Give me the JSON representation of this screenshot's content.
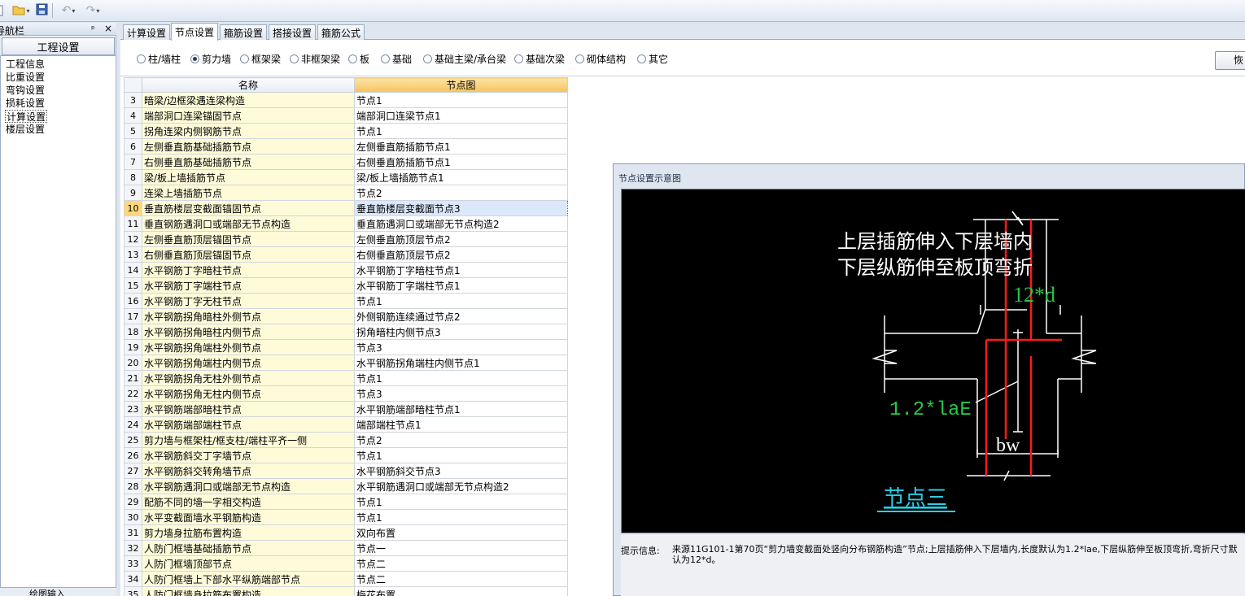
{
  "toolbar": {
    "buttons": [
      {
        "name": "open-icon"
      },
      {
        "name": "save-icon"
      },
      {
        "name": "undo-icon"
      },
      {
        "name": "redo-icon"
      }
    ]
  },
  "nav": {
    "title": "导航栏",
    "pin": "ᵖ",
    "close": "×",
    "header": "工程设置",
    "items": [
      {
        "label": "工程信息"
      },
      {
        "label": "比重设置"
      },
      {
        "label": "弯钩设置"
      },
      {
        "label": "损耗设置"
      },
      {
        "label": "计算设置",
        "selected": true
      },
      {
        "label": "楼层设置"
      }
    ],
    "bottom": "绘图输入"
  },
  "tabs": [
    {
      "label": "计算设置"
    },
    {
      "label": "节点设置",
      "active": true
    },
    {
      "label": "箍筋设置"
    },
    {
      "label": "搭接设置"
    },
    {
      "label": "箍筋公式"
    }
  ],
  "radios": [
    {
      "label": "柱/墙柱",
      "checked": false
    },
    {
      "label": "剪力墙",
      "checked": true
    },
    {
      "label": "框架梁",
      "checked": false
    },
    {
      "label": "非框架梁",
      "checked": false
    },
    {
      "label": "板",
      "checked": false
    },
    {
      "label": "基础",
      "checked": false
    },
    {
      "label": "基础主梁/承台梁",
      "checked": false
    },
    {
      "label": "基础次梁",
      "checked": false
    },
    {
      "label": "砌体结构",
      "checked": false
    },
    {
      "label": "其它",
      "checked": false
    }
  ],
  "restore_button": "恢",
  "grid": {
    "headers": {
      "name": "名称",
      "diagram": "节点图"
    },
    "rows": [
      {
        "no": "3",
        "name": "暗梁/边框梁遇连梁构造",
        "value": "节点1"
      },
      {
        "no": "4",
        "name": "端部洞口连梁锚固节点",
        "value": "端部洞口连梁节点1"
      },
      {
        "no": "5",
        "name": "拐角连梁内侧钢筋节点",
        "value": "节点1"
      },
      {
        "no": "6",
        "name": "左侧垂直筋基础插筋节点",
        "value": "左侧垂直筋插筋节点1"
      },
      {
        "no": "7",
        "name": "右侧垂直筋基础插筋节点",
        "value": "右侧垂直筋插筋节点1"
      },
      {
        "no": "8",
        "name": "梁/板上墙插筋节点",
        "value": "梁/板上墙插筋节点1"
      },
      {
        "no": "9",
        "name": "连梁上墙插筋节点",
        "value": "节点2"
      },
      {
        "no": "10",
        "name": "垂直筋楼层变截面锚固节点",
        "value": "垂直筋楼层变截面节点3",
        "selected": true
      },
      {
        "no": "11",
        "name": "垂直钢筋遇洞口或端部无节点构造",
        "value": "垂直筋遇洞口或端部无节点构造2"
      },
      {
        "no": "12",
        "name": "左侧垂直筋顶层锚固节点",
        "value": "左侧垂直筋顶层节点2"
      },
      {
        "no": "13",
        "name": "右侧垂直筋顶层锚固节点",
        "value": "右侧垂直筋顶层节点2"
      },
      {
        "no": "14",
        "name": "水平钢筋丁字暗柱节点",
        "value": "水平钢筋丁字暗柱节点1"
      },
      {
        "no": "15",
        "name": "水平钢筋丁字端柱节点",
        "value": "水平钢筋丁字端柱节点1"
      },
      {
        "no": "16",
        "name": "水平钢筋丁字无柱节点",
        "value": "节点1"
      },
      {
        "no": "17",
        "name": "水平钢筋拐角暗柱外侧节点",
        "value": "外侧钢筋连续通过节点2"
      },
      {
        "no": "18",
        "name": "水平钢筋拐角暗柱内侧节点",
        "value": "拐角暗柱内侧节点3"
      },
      {
        "no": "19",
        "name": "水平钢筋拐角端柱外侧节点",
        "value": "节点3"
      },
      {
        "no": "20",
        "name": "水平钢筋拐角端柱内侧节点",
        "value": "水平钢筋拐角端柱内侧节点1"
      },
      {
        "no": "21",
        "name": "水平钢筋拐角无柱外侧节点",
        "value": "节点1"
      },
      {
        "no": "22",
        "name": "水平钢筋拐角无柱内侧节点",
        "value": "节点3"
      },
      {
        "no": "23",
        "name": "水平钢筋端部暗柱节点",
        "value": "水平钢筋端部暗柱节点1"
      },
      {
        "no": "24",
        "name": "水平钢筋端部端柱节点",
        "value": "端部端柱节点1"
      },
      {
        "no": "25",
        "name": "剪力墙与框架柱/框支柱/端柱平齐一侧",
        "value": "节点2"
      },
      {
        "no": "26",
        "name": "水平钢筋斜交丁字墙节点",
        "value": "节点1"
      },
      {
        "no": "27",
        "name": "水平钢筋斜交转角墙节点",
        "value": "水平钢筋斜交节点3"
      },
      {
        "no": "28",
        "name": "水平钢筋遇洞口或端部无节点构造",
        "value": "水平钢筋遇洞口或端部无节点构造2"
      },
      {
        "no": "29",
        "name": "配筋不同的墙一字相交构造",
        "value": "节点1"
      },
      {
        "no": "30",
        "name": "水平变截面墙水平钢筋构造",
        "value": "节点1"
      },
      {
        "no": "31",
        "name": "剪力墙身拉筋布置构造",
        "value": "双向布置"
      },
      {
        "no": "32",
        "name": "人防门框墙基础插筋节点",
        "value": "节点一"
      },
      {
        "no": "33",
        "name": "人防门框墙顶部节点",
        "value": "节点二"
      },
      {
        "no": "34",
        "name": "人防门框墙上下部水平纵筋端部节点",
        "value": "节点二"
      },
      {
        "no": "35",
        "name": "人防门框墙身拉筋布置构造",
        "value": "梅花布置"
      }
    ]
  },
  "preview": {
    "title": "节点设置示意图",
    "diagram": {
      "line1": "上层插筋伸入下层墙内",
      "line2": "下层纵筋伸至板顶弯折",
      "dim_top": "12*d",
      "dim_anchor": "1.2*laE",
      "dim_bw": "bw",
      "caption": "节点三",
      "colors": {
        "bg": "#000000",
        "rebar": "#ff1a1a",
        "dim": "#21c94a",
        "outline": "#ffffff",
        "caption": "#26d0e8"
      }
    },
    "info_label": "提示信息:",
    "info_text": "来源11G101-1第70页“剪力墙变截面处竖向分布钢筋构造”节点;上层插筋伸入下层墙内,长度默认为1.2*lae,下层纵筋伸至板顶弯折,弯折尺寸默认为12*d。"
  }
}
